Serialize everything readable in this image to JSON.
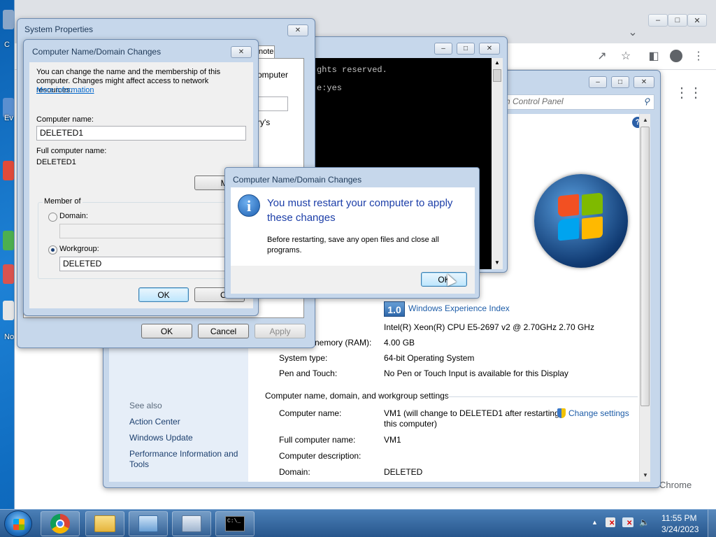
{
  "desktop": {
    "labels": [
      "C",
      "Ev",
      "No"
    ]
  },
  "browser": {
    "right_link": "Chrome",
    "search_placeholder": "rch Control Panel"
  },
  "cmd": {
    "line1": "ghts reserved.",
    "line2": "e:yes"
  },
  "system_properties": {
    "title": "System Properties",
    "tab_remote": "note",
    "partial_text1": "omputer",
    "partial_text2": "ry's",
    "ok": "OK",
    "cancel": "Cancel",
    "apply": "Apply"
  },
  "domain_changes": {
    "title": "Computer Name/Domain Changes",
    "description": "You can change the name and the membership of this computer. Changes might affect access to network resources.",
    "more_info": "More information",
    "computer_name_label": "Computer name:",
    "computer_name_value": "DELETED1",
    "full_name_label": "Full computer name:",
    "full_name_value": "DELETED1",
    "more_button": "More",
    "member_of": "Member of",
    "domain_label": "Domain:",
    "workgroup_label": "Workgroup:",
    "workgroup_value": "DELETED",
    "ok": "OK",
    "cancel": "Canc"
  },
  "restart_dialog": {
    "title": "Computer Name/Domain Changes",
    "heading": "You must restart your computer to apply these changes",
    "body": "Before restarting, save any open files and close all programs.",
    "ok": "OK"
  },
  "control_panel": {
    "wei_score": "1.0",
    "wei_link": "Windows Experience Index",
    "processor_value": "Intel(R) Xeon(R) CPU E5-2697 v2 @ 2.70GHz   2.70 GHz",
    "ram_label": "nemory (RAM):",
    "ram_value": "4.00 GB",
    "system_type_label": "System type:",
    "system_type_value": "64-bit Operating System",
    "pen_label": "Pen and Touch:",
    "pen_value": "No Pen or Touch Input is available for this Display",
    "section_title": "Computer name, domain, and workgroup settings",
    "computer_name_label": "Computer name:",
    "computer_name_value_1": "VM1 (will change to DELETED1 after restarting",
    "computer_name_value_2": "this computer)",
    "change_settings": "Change settings",
    "full_name_label": "Full computer name:",
    "full_name_value": "VM1",
    "description_label": "Computer description:",
    "domain_label": "Domain:",
    "domain_value": "DELETED",
    "see_also": "See also",
    "links": [
      "Action Center",
      "Windows Update",
      "Performance Information and",
      "Tools"
    ]
  },
  "taskbar": {
    "time": "11:55 PM",
    "date": "3/24/2023"
  }
}
